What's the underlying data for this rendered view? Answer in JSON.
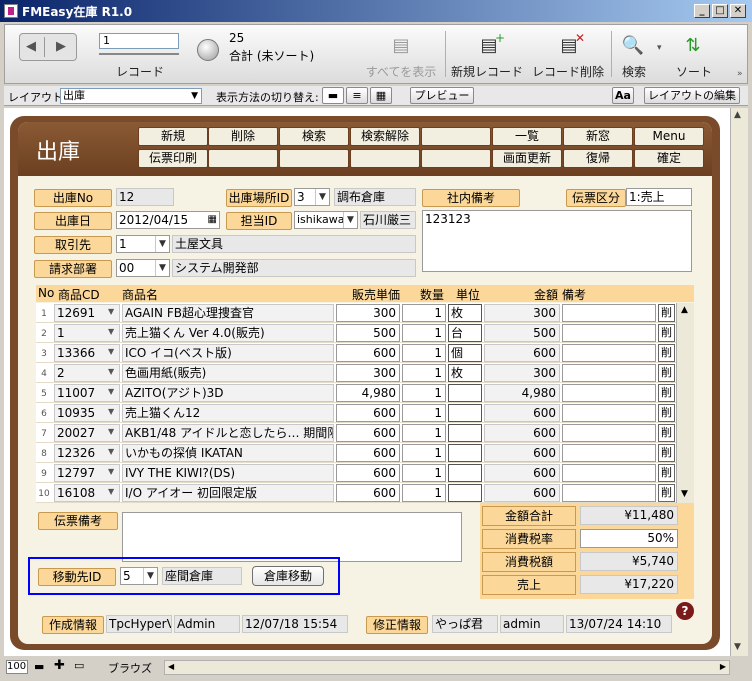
{
  "window": {
    "title": "FMEasy在庫 R1.0"
  },
  "toolbar": {
    "record_input": "1",
    "record_label": "レコード",
    "total_count": "25",
    "total_status": "合計 (未ソート)",
    "show_all": "すべてを表示",
    "new_record": "新規レコード",
    "delete_record": "レコード削除",
    "search": "検索",
    "sort": "ソート"
  },
  "layoutbar": {
    "layout_label": "レイアウト:",
    "layout_value": "出庫",
    "view_switch_label": "表示方法の切り替え:",
    "preview": "プレビュー",
    "aa": "Aa",
    "edit_layout": "レイアウトの編集"
  },
  "header": {
    "title": "出庫",
    "nav_row1": [
      "新規",
      "削除",
      "検索",
      "検索解除",
      "",
      "一覧",
      "新窓",
      "Menu"
    ],
    "nav_row2": [
      "伝票印刷",
      "",
      "",
      "",
      "",
      "画面更新",
      "復帰",
      "確定"
    ]
  },
  "form": {
    "shukko_no_label": "出庫No",
    "shukko_no": "12",
    "location_id_label": "出庫場所ID",
    "location_id": "3",
    "location_name": "調布倉庫",
    "internal_note_label": "社内備考",
    "slip_type_label": "伝票区分",
    "slip_type": "1:売上",
    "date_label": "出庫日",
    "date": "2012/04/15",
    "staff_label": "担当ID",
    "staff_id": "ishikawa",
    "staff_name": "石川厳三",
    "internal_note": "123123",
    "customer_label": "取引先",
    "customer_id": "1",
    "customer_name": "土屋文具",
    "billing_label": "請求部署",
    "billing_id": "00",
    "billing_name": "システム開発部"
  },
  "table": {
    "headers": {
      "no": "No",
      "code": "商品CD",
      "name": "商品名",
      "price": "販売単価",
      "qty": "数量",
      "unit": "単位",
      "amount": "金額",
      "note": "備考"
    },
    "delete_label": "削",
    "rows": [
      {
        "no": "1",
        "code": "12691",
        "name": "AGAIN FB超心理捜査官",
        "price": "300",
        "qty": "1",
        "unit": "枚",
        "amount": "300"
      },
      {
        "no": "2",
        "code": "1",
        "name": "売上猫くん Ver 4.0(販売)",
        "price": "500",
        "qty": "1",
        "unit": "台",
        "amount": "500"
      },
      {
        "no": "3",
        "code": "13366",
        "name": "ICO イコ(ベスト版)",
        "price": "600",
        "qty": "1",
        "unit": "個",
        "amount": "600"
      },
      {
        "no": "4",
        "code": "2",
        "name": "色画用紙(販売)",
        "price": "300",
        "qty": "1",
        "unit": "枚",
        "amount": "300"
      },
      {
        "no": "5",
        "code": "11007",
        "name": "AZITO(アジト)3D",
        "price": "4,980",
        "qty": "1",
        "unit": "",
        "amount": "4,980"
      },
      {
        "no": "6",
        "code": "10935",
        "name": "売上猫くん12",
        "price": "600",
        "qty": "1",
        "unit": "",
        "amount": "600"
      },
      {
        "no": "7",
        "code": "20027",
        "name": "AKB1/48 アイドルと恋したら… 期間限定",
        "price": "600",
        "qty": "1",
        "unit": "",
        "amount": "600"
      },
      {
        "no": "8",
        "code": "12326",
        "name": "いかもの探偵 IKATAN",
        "price": "600",
        "qty": "1",
        "unit": "",
        "amount": "600"
      },
      {
        "no": "9",
        "code": "12797",
        "name": "IVY THE KIWI?(DS)",
        "price": "600",
        "qty": "1",
        "unit": "",
        "amount": "600"
      },
      {
        "no": "10",
        "code": "16108",
        "name": "I/O アイオー 初回限定版",
        "price": "600",
        "qty": "1",
        "unit": "",
        "amount": "600"
      }
    ]
  },
  "footer": {
    "slip_note_label": "伝票備考",
    "total_label": "金額合計",
    "total": "¥11,480",
    "tax_rate_label": "消費税率",
    "tax_rate": "50%",
    "tax_label": "消費税額",
    "tax": "¥5,740",
    "sales_label": "売上",
    "sales": "¥17,220",
    "move_dest_label": "移動先ID",
    "move_dest_id": "5",
    "move_dest_name": "座間倉庫",
    "move_button": "倉庫移動",
    "created_label": "作成情報",
    "created_app": "TpcHyperV",
    "created_user": "Admin",
    "created_at": "12/07/18 15:54",
    "modified_label": "修正情報",
    "modified_app": "やっぱ君",
    "modified_user": "admin",
    "modified_at": "13/07/24 14:10"
  },
  "statusbar": {
    "zoom": "100",
    "mode": "ブラウズ"
  },
  "colors": {
    "accent": "#fbd89a",
    "frame": "#7a4b2a",
    "highlight": "#0000ff"
  }
}
